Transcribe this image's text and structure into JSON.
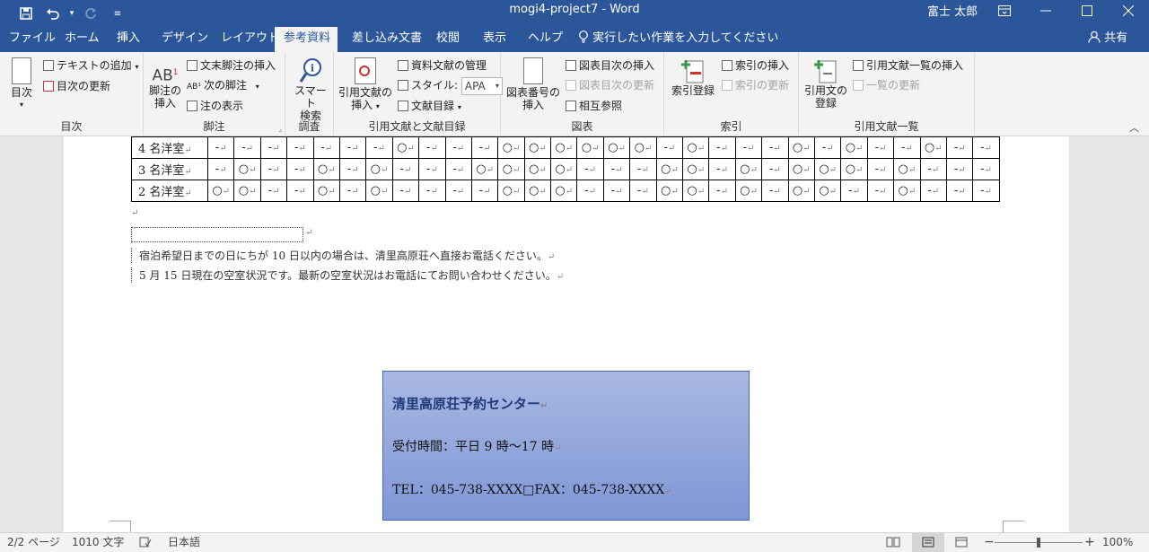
{
  "title_bar": {
    "doc_title": "mogi4-project7 - Word",
    "user": "富士 太郎",
    "save_icon": "save-icon",
    "undo_icon": "undo-icon",
    "redo_icon": "redo-icon",
    "customize_icon": "customize-qat-icon"
  },
  "tabs": [
    "ファイル",
    "ホーム",
    "挿入",
    "デザイン",
    "レイアウト",
    "参考資料",
    "差し込み文書",
    "校閲",
    "表示",
    "ヘルプ"
  ],
  "active_tab": "参考資料",
  "tellme": "実行したい作業を入力してください",
  "share": "共有",
  "ribbon": {
    "toc": {
      "label": "目次",
      "big": "目次",
      "add_text": "テキストの追加",
      "update_toc": "目次の更新"
    },
    "footnotes": {
      "label": "脚注",
      "insert_footnote_line1": "脚注の",
      "insert_footnote_line2": "挿入",
      "insert_endnote": "文末脚注の挿入",
      "next_footnote": "次の脚注",
      "show_notes": "注の表示"
    },
    "research": {
      "label": "調査",
      "smart_line1": "スマート",
      "smart_line2": "検索"
    },
    "citations": {
      "label": "引用文献と文献目録",
      "insert_citation_line1": "引用文献の",
      "insert_citation_line2": "挿入",
      "manage_sources": "資料文献の管理",
      "style_label": "スタイル:",
      "style_value": "APA",
      "bibliography": "文献目録"
    },
    "captions": {
      "label": "図表",
      "insert_caption_line1": "図表番号の",
      "insert_caption_line2": "挿入",
      "insert_tof": "図表目次の挿入",
      "update_table": "図表目次の更新",
      "cross_ref": "相互参照"
    },
    "index": {
      "label": "索引",
      "mark_entry": "索引登録",
      "insert_index": "索引の挿入",
      "update_index": "索引の更新"
    },
    "toa": {
      "label": "引用文献一覧",
      "mark_citation_line1": "引用文の",
      "mark_citation_line2": "登録",
      "insert_toa": "引用文献一覧の挿入",
      "update_toa": "一覧の更新"
    }
  },
  "table": {
    "rows": [
      {
        "label": "4 名洋室",
        "cells": [
          "-",
          "-",
          "-",
          "-",
          "-",
          "-",
          "-",
          "○",
          "-",
          "-",
          "-",
          "○",
          "○",
          "○",
          "○",
          "○",
          "○",
          "-",
          "○",
          "-",
          "-",
          "-",
          "○",
          "-",
          "○",
          "-",
          "-",
          "○",
          "-",
          "-"
        ]
      },
      {
        "label": "3 名洋室",
        "cells": [
          "-",
          "○",
          "-",
          "-",
          "○",
          "-",
          "○",
          "-",
          "-",
          "-",
          "○",
          "○",
          "○",
          "○",
          "-",
          "-",
          "-",
          "○",
          "○",
          "-",
          "○",
          "-",
          "○",
          "○",
          "○",
          "-",
          "○",
          "-",
          "-",
          "-"
        ]
      },
      {
        "label": "2 名洋室",
        "cells": [
          "○",
          "○",
          "-",
          "-",
          "○",
          "-",
          "○",
          "-",
          "-",
          "-",
          "-",
          "○",
          "○",
          "○",
          "-",
          "-",
          "-",
          "○",
          "○",
          "-",
          "○",
          "-",
          "○",
          "○",
          "-",
          "-",
          "○",
          "-",
          "-",
          "-"
        ]
      }
    ]
  },
  "paragraphs": {
    "note1": "宿泊希望日までの日にちが 10 日以内の場合は、清里高原荘へ直接お電話ください。",
    "note2": "5 月 15 日現在の空室状況です。最新の空室状況はお電話にてお問い合わせください。"
  },
  "textbox": {
    "title": "清里高原荘予約センター",
    "hours": "受付時間：平日 9 時～17 時",
    "contact": "TEL：045-738-XXXX□FAX：045-738-XXXX"
  },
  "status": {
    "page": "2/2 ページ",
    "words": "1010 文字",
    "language": "日本語",
    "zoom": "100%",
    "zoom_level": 1.0
  },
  "colors": {
    "accent": "#2b579a",
    "textbox_fill": "#8ea3dc"
  }
}
